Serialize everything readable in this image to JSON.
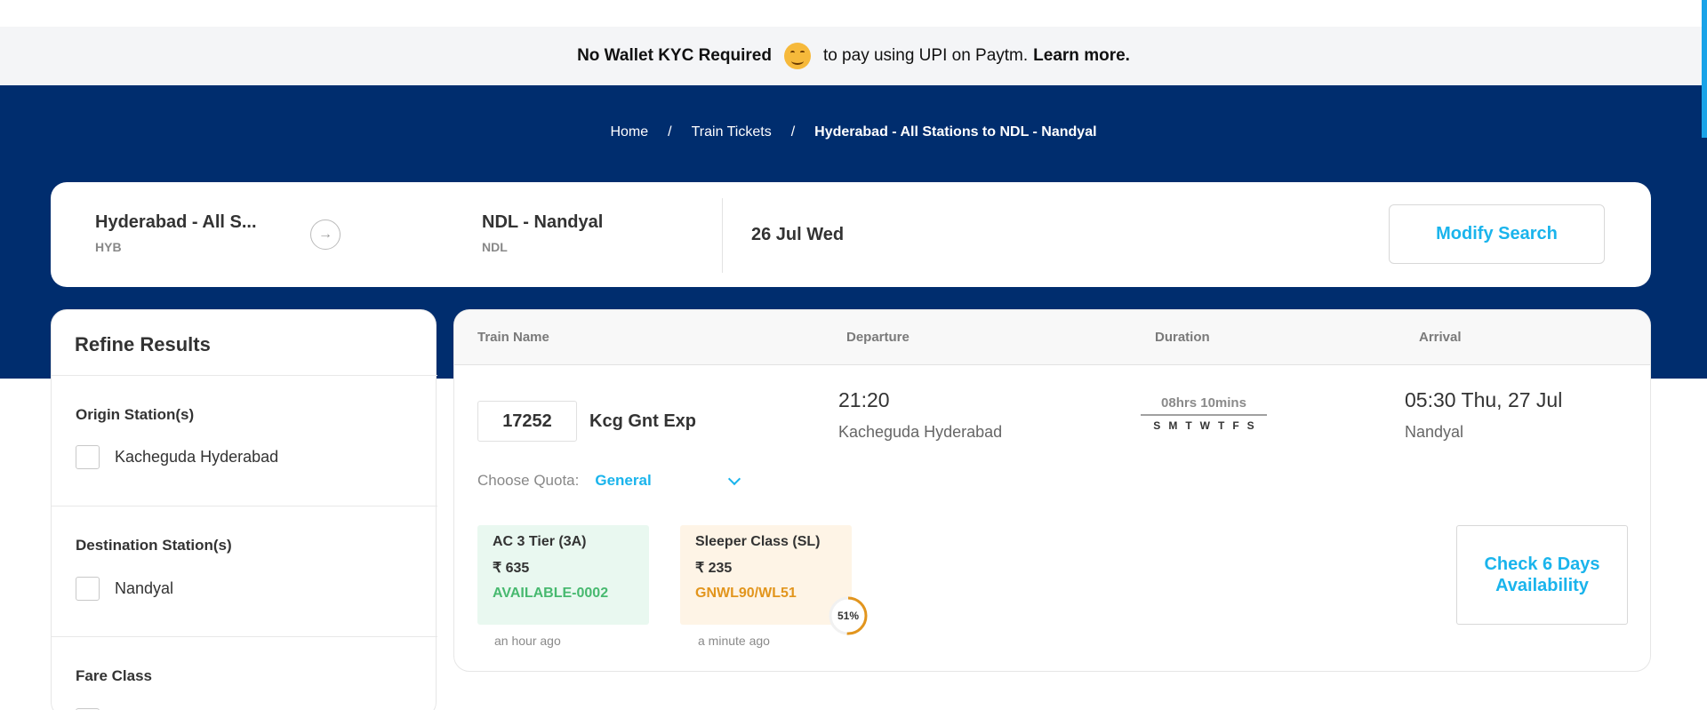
{
  "promo": {
    "bold_text": "No Wallet KYC Required",
    "middle_text": "to pay using UPI on Paytm.",
    "link_text": "Learn more."
  },
  "breadcrumb": {
    "items": [
      "Home",
      "Train Tickets",
      "Hyderabad - All Stations to NDL - Nandyal"
    ],
    "separator": "/"
  },
  "search": {
    "from_city": "Hyderabad - All S...",
    "from_code": "HYB",
    "to_city": "NDL - Nandyal",
    "to_code": "NDL",
    "date": "26 Jul Wed",
    "modify_label": "Modify Search"
  },
  "refine": {
    "title": "Refine Results",
    "origin_heading": "Origin Station(s)",
    "origin_option": "Kacheguda Hyderabad",
    "destination_heading": "Destination Station(s)",
    "destination_option": "Nandyal",
    "fare_class_heading": "Fare Class"
  },
  "results": {
    "columns": [
      "Train Name",
      "Departure",
      "Duration",
      "Arrival"
    ],
    "train": {
      "number": "17252",
      "name": "Kcg Gnt Exp",
      "departure_time": "21:20",
      "departure_station": "Kacheguda Hyderabad",
      "duration": "08hrs 10mins",
      "days": [
        "S",
        "M",
        "T",
        "W",
        "T",
        "F",
        "S"
      ],
      "arrival_time": "05:30 Thu, 27 Jul",
      "arrival_station": "Nandyal",
      "quota_label": "Choose Quota:",
      "quota_value": "General",
      "classes": [
        {
          "name": "AC 3 Tier (3A)",
          "fare": "₹ 635",
          "status": "AVAILABLE-0002",
          "updated": "an hour ago"
        },
        {
          "name": "Sleeper Class (SL)",
          "fare": "₹ 235",
          "status": "GNWL90/WL51",
          "updated": "a minute ago",
          "confirm_chance_label": "51%",
          "confirm_chance": 0.51
        }
      ],
      "check_label": "Check 6 Days Availability"
    }
  },
  "colors": {
    "hero_bg": "#002d6e",
    "accent": "#1ab4ec",
    "available": "#47b96f",
    "waitlist": "#e2951d"
  }
}
